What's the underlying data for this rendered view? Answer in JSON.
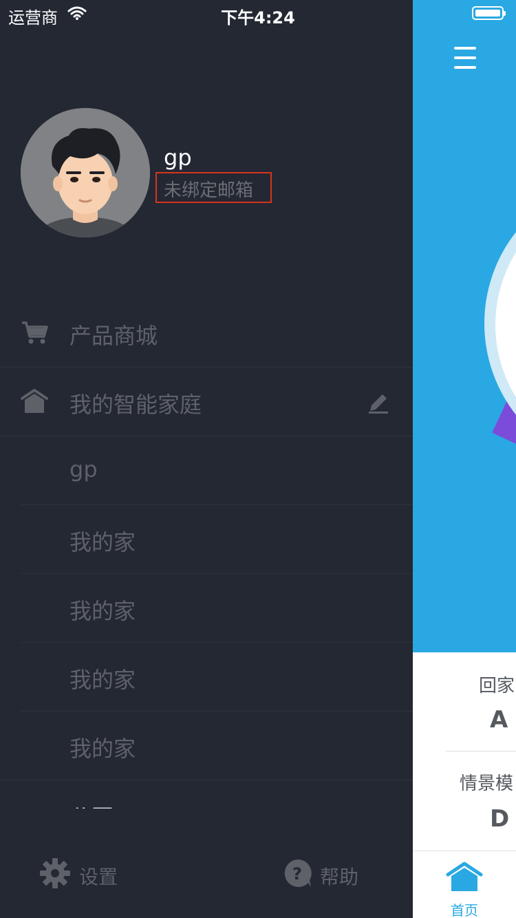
{
  "status_bar": {
    "carrier": "运营商",
    "time": "下午4:24"
  },
  "profile": {
    "username": "gp",
    "email_status": "未绑定邮箱"
  },
  "menu": {
    "shop_label": "产品商城",
    "smart_home_label": "我的智能家庭",
    "homes": [
      "gp",
      "我的家",
      "我的家",
      "我的家",
      "我的家"
    ],
    "partial_item": "公园"
  },
  "bottom": {
    "settings_label": "设置",
    "help_label": "帮助"
  },
  "main": {
    "scene_1_label": "回家",
    "scene_1_letter": "A",
    "scene_2_label": "情景模",
    "scene_2_letter": "D",
    "tab_home_label": "首页"
  },
  "colors": {
    "drawer_bg": "#232833",
    "accent": "#2aa8e3",
    "highlight_border": "#d9341c"
  }
}
